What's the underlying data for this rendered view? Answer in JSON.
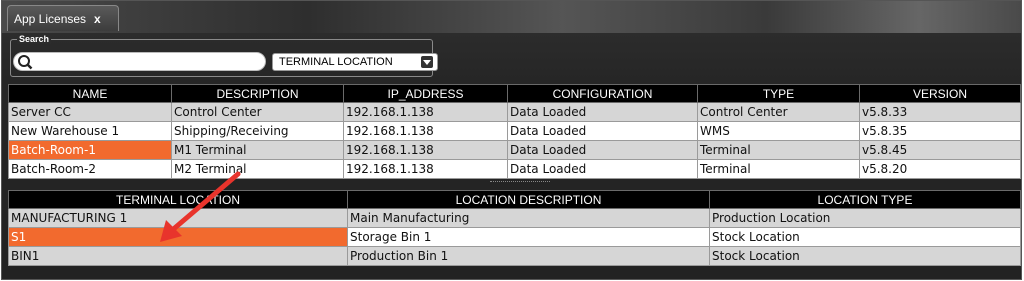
{
  "window": {
    "tab_title": "App Licenses",
    "tab_close": "x"
  },
  "search": {
    "legend": "Search",
    "value": "",
    "placeholder": "",
    "filter_selected": "TERMINAL LOCATION"
  },
  "colors": {
    "selected_row": "#f26a2e",
    "header_bg": "#000000",
    "annotation_arrow": "#e8342c"
  },
  "licenses": {
    "headers": {
      "name": "NAME",
      "description": "DESCRIPTION",
      "ip": "IP_ADDRESS",
      "configuration": "CONFIGURATION",
      "type": "TYPE",
      "version": "VERSION"
    },
    "rows": [
      {
        "name": "Server CC",
        "description": "Control Center",
        "ip": "192.168.1.138",
        "configuration": "Data Loaded",
        "type": "Control Center",
        "version": "v5.8.33"
      },
      {
        "name": "New Warehouse 1",
        "description": "Shipping/Receiving",
        "ip": "192.168.1.138",
        "configuration": "Data Loaded",
        "type": "WMS",
        "version": "v5.8.35"
      },
      {
        "name": "Batch-Room-1",
        "description": "M1 Terminal",
        "ip": "192.168.1.138",
        "configuration": "Data Loaded",
        "type": "Terminal",
        "version": "v5.8.45"
      },
      {
        "name": "Batch-Room-2",
        "description": "M2 Terminal",
        "ip": "192.168.1.138",
        "configuration": "Data Loaded",
        "type": "Terminal",
        "version": "v5.8.20"
      }
    ]
  },
  "locations": {
    "headers": {
      "terminal_location": "TERMINAL LOCATION",
      "location_description": "LOCATION DESCRIPTION",
      "location_type": "LOCATION TYPE"
    },
    "rows": [
      {
        "terminal_location": "MANUFACTURING 1",
        "location_description": "Main Manufacturing",
        "location_type": "Production Location"
      },
      {
        "terminal_location": "S1",
        "location_description": "Storage Bin 1",
        "location_type": "Stock Location"
      },
      {
        "terminal_location": "BIN1",
        "location_description": "Production Bin 1",
        "location_type": "Stock Location"
      }
    ]
  }
}
